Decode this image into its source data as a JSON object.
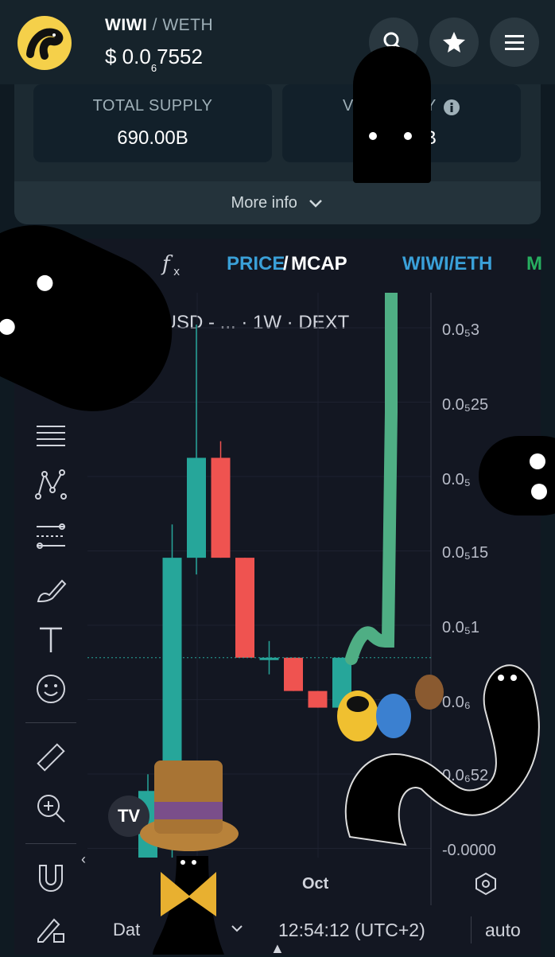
{
  "header": {
    "base_symbol": "WIWI",
    "separator": "/",
    "quote_symbol": "WETH",
    "price_prefix": "$ 0.0",
    "price_zeros": "6",
    "price_digits": "7552",
    "buttons": [
      "search-icon",
      "star-icon",
      "menu-icon"
    ]
  },
  "stats": {
    "total_supply_label": "TOTAL SUPPLY",
    "total_supply_value": "690.00B",
    "second_label_partial": "V",
    "second_label_partial_end": "Y",
    "second_value_partial": "B"
  },
  "more_info": {
    "label": "More info"
  },
  "chart_toolbar": {
    "price_label": "PRICE",
    "slash": "/",
    "mcap_label": "MCAP",
    "pair_label": "WIWI/ETH",
    "cut_label": "M"
  },
  "legend": {
    "text": "/USD - ... · 1W · DEXT"
  },
  "time_bar": {
    "date_label": "Dat",
    "time": "12:54:12 (UTC+2)",
    "auto": "auto",
    "x_label": "Oct"
  },
  "colors": {
    "up": "#26a69a",
    "down": "#ef5350",
    "accent": "#3aa0d8",
    "green_text": "#27ae60"
  },
  "chart_data": {
    "type": "candlestick",
    "title": "",
    "xlabel": "",
    "ylabel": "",
    "y_tick_labels": [
      "0.0₅3",
      "0.0₅25",
      "0.0₅",
      "0.0₅15",
      "0.0₅1",
      "0.0₆",
      "0.0₆52",
      "-0.0000"
    ],
    "x_tick_labels": [
      "Oct"
    ],
    "ylim": [
      0,
      3.2e-06
    ],
    "candles": [
      {
        "o": 0.0,
        "h": 5e-07,
        "l": 0.0,
        "c": 4e-07
      },
      {
        "o": 4e-07,
        "h": 2e-06,
        "l": 0.0,
        "c": 1.8e-06
      },
      {
        "o": 1.8e-06,
        "h": 3.2e-06,
        "l": 1.7e-06,
        "c": 2.4e-06
      },
      {
        "o": 2.4e-06,
        "h": 2.5e-06,
        "l": 1.8e-06,
        "c": 1.8e-06
      },
      {
        "o": 1.8e-06,
        "h": 1.8e-06,
        "l": 1.2e-06,
        "c": 1.2e-06
      },
      {
        "o": 1.2e-06,
        "h": 1.3e-06,
        "l": 1.1e-06,
        "c": 1.2e-06
      },
      {
        "o": 1.2e-06,
        "h": 1.2e-06,
        "l": 1e-06,
        "c": 1e-06
      },
      {
        "o": 1e-06,
        "h": 1e-06,
        "l": 9e-07,
        "c": 9e-07
      },
      {
        "o": 9e-07,
        "h": 1.2e-06,
        "l": 9e-07,
        "c": 1.2e-06
      }
    ],
    "current_price_line": 1.2e-06
  }
}
